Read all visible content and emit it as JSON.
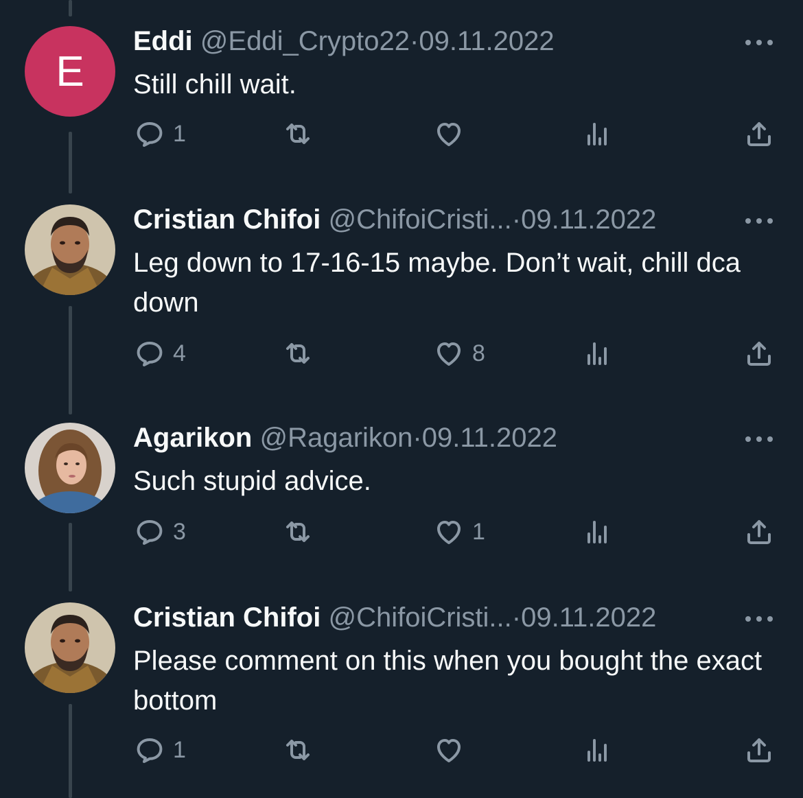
{
  "tweets": [
    {
      "avatar_letter": "E",
      "name": "Eddi",
      "handle": "@Eddi_Crypto22",
      "separator": "·",
      "date": "09.11.2022",
      "text": "Still chill wait.",
      "replies": "1",
      "retweets": "",
      "likes": ""
    },
    {
      "name": "Cristian Chifoi",
      "handle": "@ChifoiCristi...",
      "separator": "·",
      "date": "09.11.2022",
      "text": "Leg down to 17-16-15 maybe. Don’t wait, chill dca down",
      "replies": "4",
      "retweets": "",
      "likes": "8"
    },
    {
      "name": "Agarikon",
      "handle": "@Ragarikon",
      "separator": "·",
      "date": "09.11.2022",
      "text": "Such stupid advice.",
      "replies": "3",
      "retweets": "",
      "likes": "1"
    },
    {
      "name": "Cristian Chifoi",
      "handle": "@ChifoiCristi...",
      "separator": "·",
      "date": "09.11.2022",
      "text": "Please comment on this when you bought the exact bottom",
      "replies": "1",
      "retweets": "",
      "likes": ""
    }
  ],
  "icons": {
    "reply": "reply-icon",
    "retweet": "retweet-icon",
    "like": "heart-icon",
    "views": "views-icon",
    "share": "share-icon",
    "more": "more-icon"
  },
  "colors": {
    "background": "#15202b",
    "text_primary": "#f7f9f9",
    "text_secondary": "#8b98a5",
    "thread_line": "#38444d",
    "avatar_e": "#c8335f"
  }
}
